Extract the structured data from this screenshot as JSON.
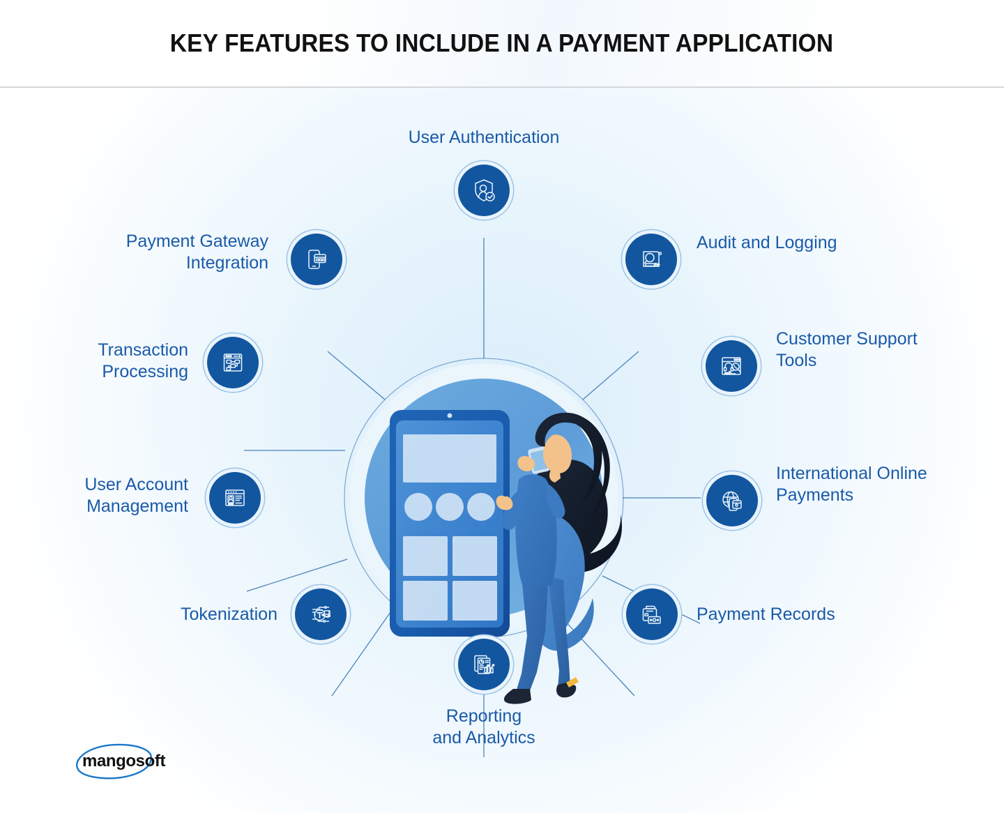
{
  "header": {
    "title": "KEY FEATURES TO INCLUDE IN A PAYMENT APPLICATION"
  },
  "brand": {
    "logo_text": "mangosoft",
    "accent_color": "#1a78c8",
    "badge_color": "#12569f",
    "label_color": "#1a5aa8",
    "title_color": "#111111"
  },
  "center": {
    "illustration_name": "woman-with-smartphone-and-large-tablet",
    "circle_color": "#5b9bd5"
  },
  "features": [
    {
      "id": "user-authentication",
      "label": "User Authentication",
      "icon": "shield-user-check-icon",
      "position": "top"
    },
    {
      "id": "audit-and-logging",
      "label": "Audit and Logging",
      "icon": "magnifier-document-icon",
      "position": "top-right"
    },
    {
      "id": "customer-support-tools",
      "label": "Customer Support\nTools",
      "icon": "headset-window-icon",
      "position": "right-upper"
    },
    {
      "id": "international-online-payments",
      "label": "International Online\nPayments",
      "icon": "globe-wallet-icon",
      "position": "right-lower"
    },
    {
      "id": "payment-records",
      "label": "Payment Records",
      "icon": "printer-receipt-money-icon",
      "position": "bottom-right"
    },
    {
      "id": "reporting-and-analytics",
      "label": "Reporting\nand Analytics",
      "icon": "report-chart-document-icon",
      "position": "bottom"
    },
    {
      "id": "tokenization",
      "label": "Tokenization",
      "icon": "circuit-token-icon",
      "position": "bottom-left"
    },
    {
      "id": "user-account-management",
      "label": "User Account\nManagement",
      "icon": "profile-card-window-icon",
      "position": "left-lower"
    },
    {
      "id": "transaction-processing",
      "label": "Transaction\nProcessing",
      "icon": "flowchart-window-icon",
      "position": "left-upper"
    },
    {
      "id": "payment-gateway-integration",
      "label": "Payment Gateway\nIntegration",
      "icon": "phone-credit-card-icon",
      "position": "top-left"
    }
  ]
}
